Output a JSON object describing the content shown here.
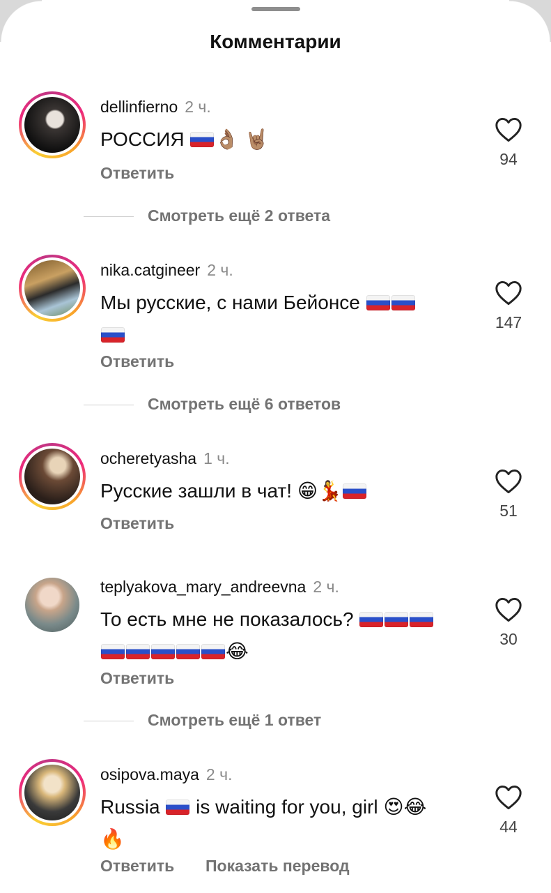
{
  "header": {
    "title": "Комментарии"
  },
  "icons": {
    "heart": "heart-outline-icon",
    "flag": "russia-flag-icon"
  },
  "comments": [
    {
      "username": "dellinfierno",
      "time": "2 ч.",
      "text_parts": [
        "РОССИЯ "
      ],
      "emojis": [
        "👌🏽",
        "🤘🏽"
      ],
      "likes": "94",
      "reply_label": "Ответить",
      "more_replies": "Смотреть ещё 2 ответа"
    },
    {
      "username": "nika.catgineer",
      "time": "2 ч.",
      "text": "Мы русские, с нами Бейонсе",
      "likes": "147",
      "reply_label": "Ответить",
      "more_replies": "Смотреть ещё 6 ответов"
    },
    {
      "username": "ocheretyasha",
      "time": "1 ч.",
      "text": "Русские зашли в чат!",
      "emojis": [
        "😁",
        "💃"
      ],
      "likes": "51",
      "reply_label": "Ответить"
    },
    {
      "username": "teplyakova_mary_andreevna",
      "time": "2 ч.",
      "text": "То есть мне не показалось?",
      "emojis": [
        "😂"
      ],
      "likes": "30",
      "reply_label": "Ответить",
      "more_replies": "Смотреть ещё 1 ответ"
    },
    {
      "username": "osipova.maya",
      "time": "2 ч.",
      "text_before": "Russia",
      "text_after": "is waiting for you, girl",
      "emojis": [
        "😍",
        "😂",
        "🔥"
      ],
      "likes": "44",
      "reply_label": "Ответить",
      "translate_label": "Показать перевод"
    }
  ],
  "colors": {
    "accent_ring_start": "#f9ce34",
    "accent_ring_mid": "#ee2a7b",
    "muted_text": "#737373"
  }
}
